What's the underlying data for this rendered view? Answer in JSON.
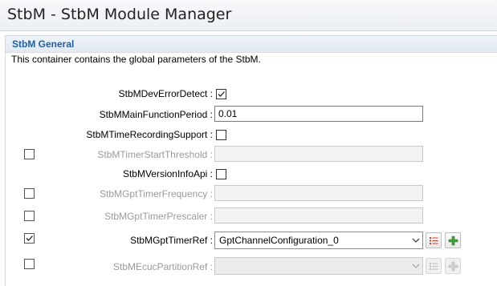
{
  "window": {
    "title": "StbM - StbM Module Manager"
  },
  "section": {
    "title": "StbM General",
    "description": "This container contains the global parameters of the StbM."
  },
  "fields": {
    "dev_error_detect": {
      "label": "StbMDevErrorDetect :",
      "checked": true
    },
    "main_function_period": {
      "label": "StbMMainFunctionPeriod :",
      "value": "0.01"
    },
    "time_recording_support": {
      "label": "StbMTimeRecordingSupport :",
      "checked": false
    },
    "timer_start_threshold": {
      "label": "StbMTimerStartThreshold :",
      "enabled": false,
      "value": ""
    },
    "version_info_api": {
      "label": "StbMVersionInfoApi :",
      "checked": false
    },
    "gpt_timer_frequency": {
      "label": "StbMGptTimerFrequency :",
      "enabled": false,
      "value": ""
    },
    "gpt_timer_prescaler": {
      "label": "StbMGptTimerPrescaler :",
      "enabled": false,
      "value": ""
    },
    "gpt_timer_ref": {
      "label": "StbMGptTimerRef :",
      "enabled": true,
      "value": "GptChannelConfiguration_0"
    },
    "ecuc_partition_ref": {
      "label": "StbMEcucPartitionRef :",
      "enabled": false,
      "value": ""
    }
  },
  "icons": {
    "list": "list-icon",
    "add": "plus-icon",
    "dropdown": "chevron-down-icon"
  },
  "colors": {
    "section_title": "#1d5fa8",
    "disabled_text": "#9a9a9a",
    "plus_green": "#3aa535",
    "list_red": "#d23a2a"
  }
}
